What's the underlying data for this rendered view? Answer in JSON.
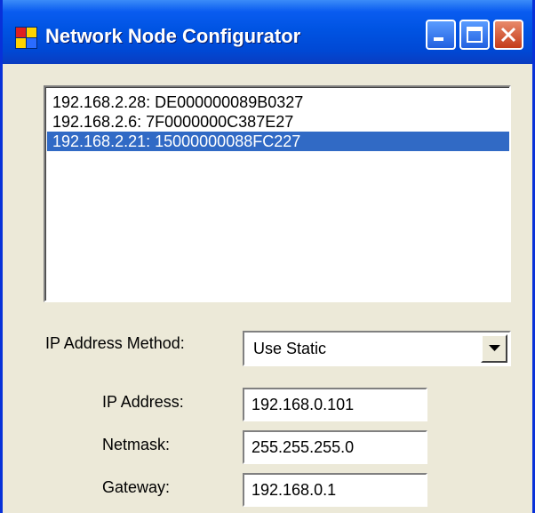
{
  "window": {
    "title": "Network Node Configurator"
  },
  "nodes": [
    "192.168.2.28: DE000000089B0327",
    "192.168.2.6: 7F0000000C387E27",
    "192.168.2.21: 15000000088FC227"
  ],
  "selected_node_index": 2,
  "form": {
    "method_label": "IP Address Method:",
    "method_value": "Use Static",
    "ip_label": "IP Address:",
    "ip_value": "192.168.0.101",
    "netmask_label": "Netmask:",
    "netmask_value": "255.255.255.0",
    "gateway_label": "Gateway:",
    "gateway_value": "192.168.0.1"
  },
  "icons": {
    "app": "app-window-icon",
    "minimize": "minimize-icon",
    "maximize": "maximize-icon",
    "close": "close-icon",
    "dropdown": "dropdown-arrow-icon"
  },
  "colors": {
    "titlebar": "#0054e3",
    "selection": "#316ac5",
    "window_bg": "#ece9d8",
    "close_button": "#c43c1a"
  }
}
